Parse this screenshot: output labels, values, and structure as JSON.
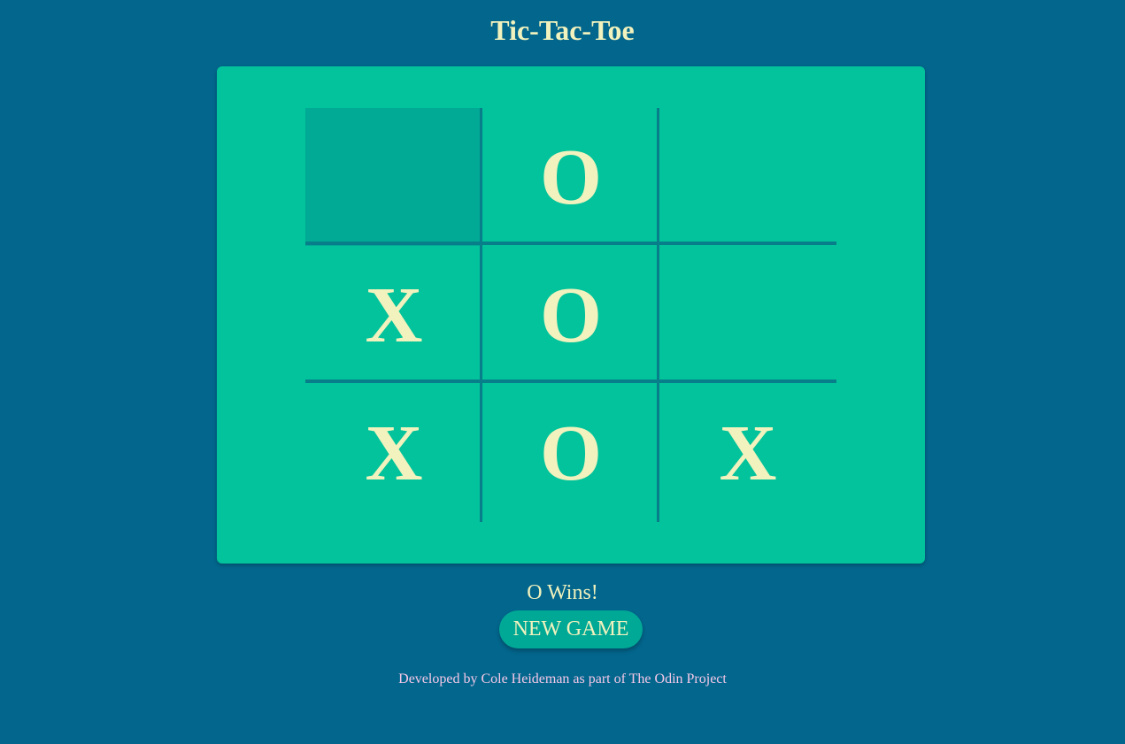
{
  "title": "Tic-Tac-Toe",
  "board": {
    "cells": [
      "",
      "O",
      "",
      "X",
      "O",
      "",
      "X",
      "O",
      "X"
    ],
    "highlighted_cell": 0
  },
  "status": "O Wins!",
  "new_game_label": "NEW GAME",
  "footer": "Developed by Cole Heideman as part of The Odin Project",
  "colors": {
    "background": "#03668d",
    "board": "#02c39b",
    "highlight": "#00aa94",
    "grid_lines": "#087e8a",
    "mark": "#f1f2bd",
    "button": "#00a896",
    "footer_text": "#f4c8e8"
  }
}
